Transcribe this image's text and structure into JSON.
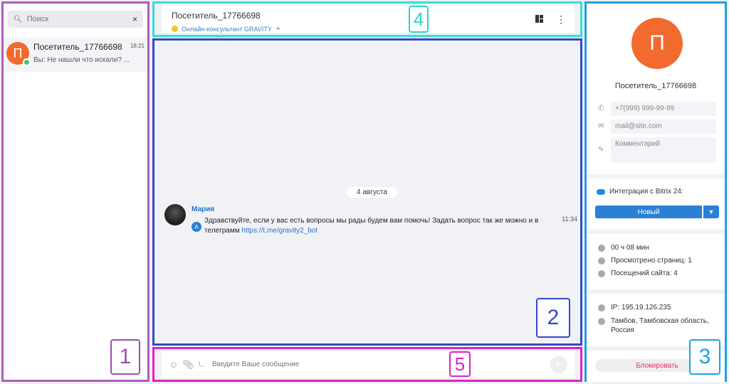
{
  "left": {
    "search_placeholder": "Поиск",
    "clear_icon": "×",
    "chats": [
      {
        "initial": "П",
        "name": "Посетитель_17766698",
        "preview": "Вы: Не нашли что искали? ...",
        "time": "18:21"
      }
    ],
    "badge": "1"
  },
  "header": {
    "title": "Посетитель_17766698",
    "subtitle": "Онлайн-консультант GRAVITY",
    "badge": "4"
  },
  "messages": {
    "date": "4 августа",
    "items": [
      {
        "author": "Мария",
        "badge": "А",
        "text": "Здравствуйте, если у вас есть вопросы мы рады будем вам помочь! Задать вопрос так же можно и в телеграмм ",
        "link": "https://t.me/gravity2_bot",
        "time": "11:34"
      }
    ],
    "badge": "2"
  },
  "input": {
    "placeholder": "Введите Ваше сообщение",
    "quick_icon": "\\..",
    "badge": "5"
  },
  "right": {
    "initial": "П",
    "name": "Посетитель_17766698",
    "phone_placeholder": "+7(999) 999-99-99",
    "email_placeholder": "mail@site.com",
    "comment_placeholder": "Комментарий",
    "integration_label": "Интеграция с Bitrix 24:",
    "status_value": "Новый",
    "stats": {
      "time": "00 ч 08 мин",
      "pages": "Просмотрено страниц: 1",
      "visits": "Посещений сайта: 4"
    },
    "ip": "IP: 195.19.126.235",
    "location": "Тамбов, Тамбовская область, Россия",
    "block_label": "Блокировать",
    "badge": "3"
  },
  "colors": {
    "accent": "#2a80d4",
    "avatar": "#f26a2e",
    "online": "#3fc67e",
    "block": "#e0336a"
  }
}
